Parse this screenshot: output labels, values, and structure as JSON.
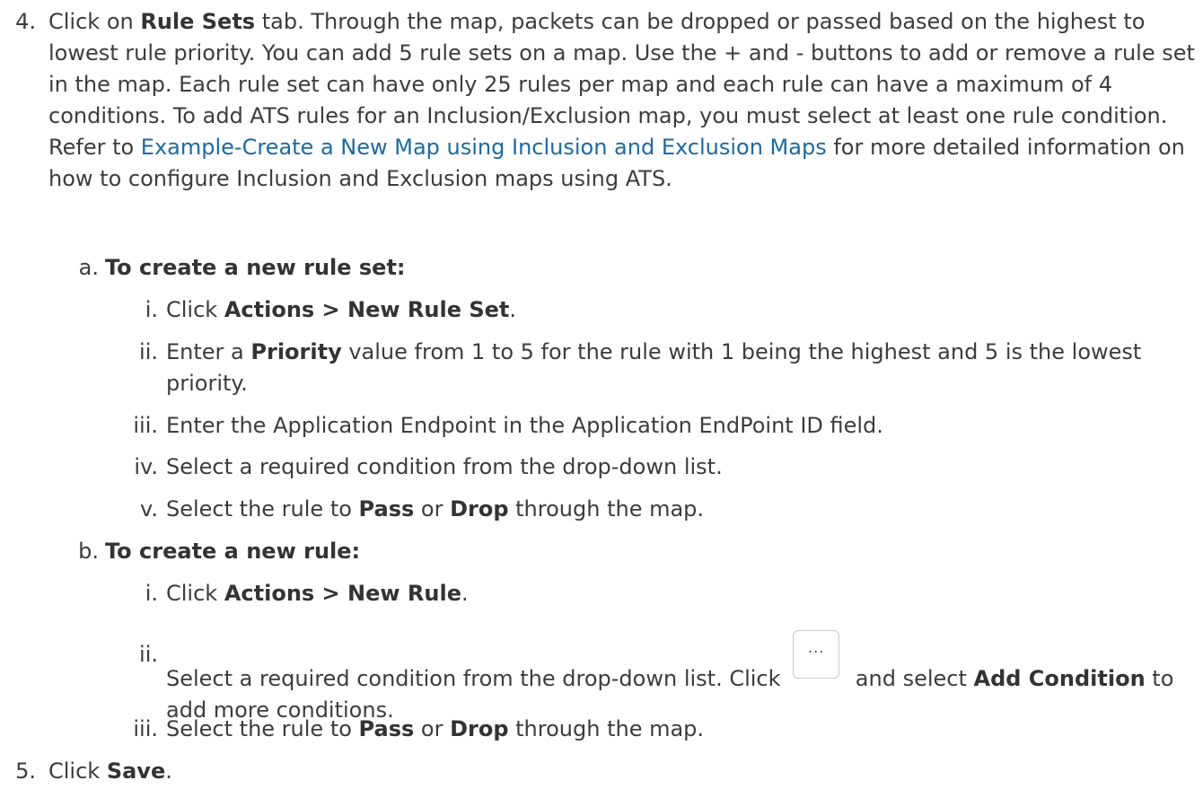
{
  "step4": {
    "num": "4.",
    "p1": "Click on ",
    "b1": "Rule Sets",
    "p2": " tab. Through the map, packets can be dropped or passed based on the highest to lowest rule priority. You can add 5 rule sets on a map. Use the + and - buttons to add or remove a rule set in the map. Each rule set can have only 25 rules per map and each rule can have a maximum of 4 conditions. To add ATS rules for an Inclusion/Exclusion map, you must select at least one rule condition. Refer to ",
    "link": "Example-Create a New Map using Inclusion and Exclusion Maps",
    "p3": " for more detailed information on how to configure Inclusion and Exclusion maps using ATS."
  },
  "subA": {
    "num": "a.",
    "heading": "To create a new rule set:",
    "items": [
      {
        "num": "i.",
        "p1": "Click ",
        "b1": "Actions > New Rule Set",
        "p2": "."
      },
      {
        "num": "ii.",
        "p1": "Enter a ",
        "b1": "Priority",
        "p2": " value from 1 to 5 for the rule with 1 being the highest and 5 is the lowest priority."
      },
      {
        "num": "iii.",
        "p1": "Enter the Application Endpoint in the Application EndPoint ID field."
      },
      {
        "num": "iv.",
        "p1": "Select a required condition from the drop-down list."
      },
      {
        "num": "v.",
        "p1": "Select the rule to ",
        "b1": "Pass",
        "p2": " or ",
        "b2": "Drop",
        "p3": " through the map."
      }
    ]
  },
  "subB": {
    "num": "b.",
    "heading": "To create a new rule:",
    "items": [
      {
        "num": "i.",
        "p1": "Click ",
        "b1": "Actions > New Rule",
        "p2": "."
      },
      {
        "num": "ii.",
        "p1": "Select a required condition from the drop-down list. Click ",
        "button_label": "...",
        "p2": " and select ",
        "b1": "Add Condition",
        "p3": " to add more conditions."
      },
      {
        "num": "iii.",
        "p1": "Select the rule to ",
        "b1": "Pass",
        "p2": " or ",
        "b2": "Drop",
        "p3": " through the map."
      }
    ]
  },
  "step5": {
    "num": "5.",
    "p1": "Click ",
    "b1": "Save",
    "p2": "."
  }
}
